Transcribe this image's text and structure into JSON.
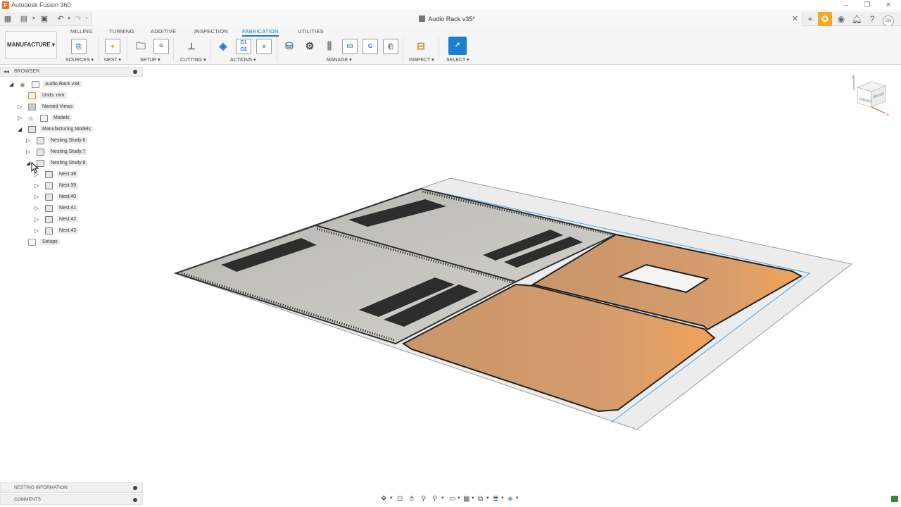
{
  "app": {
    "title": "Autodesk Fusion 360",
    "logo_letter": "F",
    "document_name": "Audio Rack v35*",
    "user_initials": "SH"
  },
  "workspace": {
    "label": "MANUFACTURE ▾"
  },
  "ribbon": {
    "tabs": [
      "MILLING",
      "TURNING",
      "ADDITIVE",
      "INSPECTION",
      "FABRICATION",
      "UTILITIES"
    ],
    "active_tab": "FABRICATION",
    "groups": {
      "sources": "SOURCES ▾",
      "nest": "NEST ▾",
      "setup": "SETUP ▾",
      "cutting": "CUTTING ▾",
      "actions": "ACTIONS ▾",
      "manage": "MANAGE ▾",
      "inspect": "INSPECT ▾",
      "select": "SELECT ▾"
    },
    "actions_gcode_label": "G1\nG2"
  },
  "browser": {
    "header": "BROWSER",
    "items": [
      {
        "label": "Audio Rack v34"
      },
      {
        "label": "Units: mm"
      },
      {
        "label": "Named Views"
      },
      {
        "label": "Models"
      },
      {
        "label": "Manufacturing Models"
      },
      {
        "label": "Nesting Study:6"
      },
      {
        "label": "Nesting Study:7"
      },
      {
        "label": "Nesting Study:8"
      },
      {
        "label": "Nest:38"
      },
      {
        "label": "Nest:39"
      },
      {
        "label": "Nest:40"
      },
      {
        "label": "Nest:41"
      },
      {
        "label": "Nest:42"
      },
      {
        "label": "Nest:43"
      },
      {
        "label": "Setups"
      }
    ]
  },
  "bottom_panels": {
    "nesting_info": "NESTING INFORMATION",
    "comments": "COMMENTS"
  },
  "viewcube": {
    "front": "FRONT",
    "right": "RIGHT",
    "z": "Z",
    "x": "X"
  },
  "colors": {
    "accent": "#1a7ac6",
    "sheet_material": "#d9a273",
    "stock": "#e8e8e8",
    "toolpath_gray": "#c9c8c3"
  }
}
